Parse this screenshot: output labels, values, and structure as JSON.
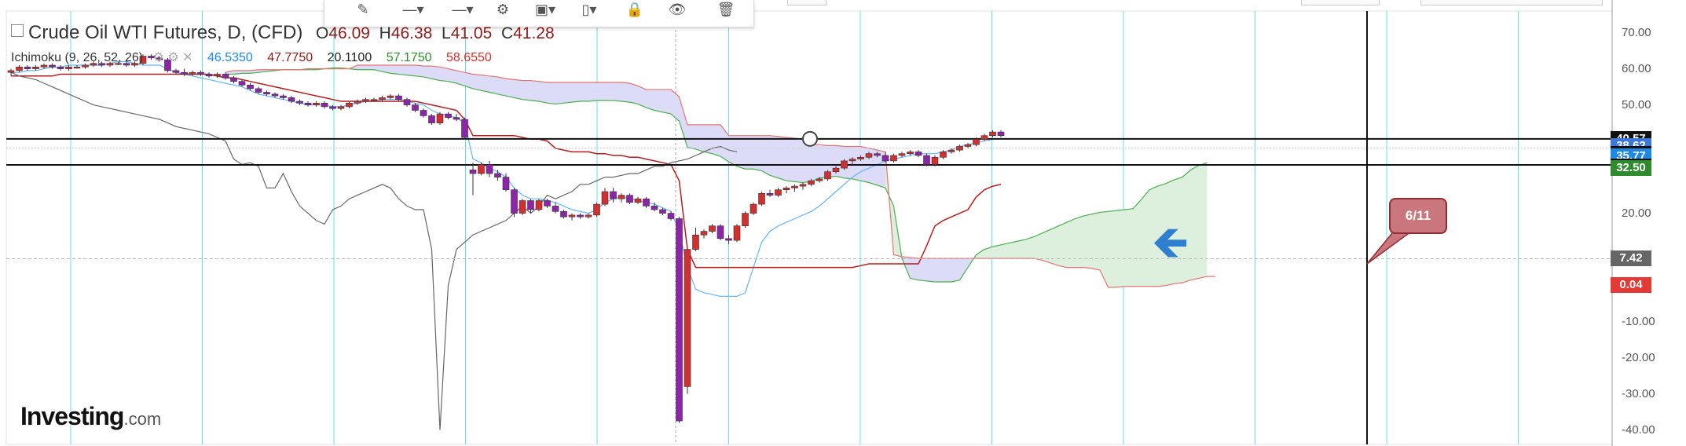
{
  "header": {
    "title": "Crude Oil WTI Futures, D, (CFD)",
    "open_label": "O",
    "open": "46.09",
    "high_label": "H",
    "high": "46.38",
    "low_label": "L",
    "low": "41.05",
    "close_label": "C",
    "close": "41.28"
  },
  "indicator": {
    "name": "Ichimoku (9, 26, 52, 26)",
    "values": [
      {
        "text": "46.5350",
        "color": "#1e88e5"
      },
      {
        "text": "47.7750",
        "color": "#8b1a1a"
      },
      {
        "text": "20.1100",
        "color": "#222222"
      },
      {
        "text": "57.1750",
        "color": "#2e8b2e"
      },
      {
        "text": "58.6550",
        "color": "#d32f2f"
      }
    ]
  },
  "toolbar": {
    "items": [
      "pencil-icon",
      "line-style-icon",
      "line-width-icon",
      "gear-icon",
      "copy-icon",
      "template-icon",
      "lock-icon",
      "eye-icon",
      "trash-icon"
    ]
  },
  "annotation": {
    "callout": "6/11"
  },
  "logo": {
    "main": "Investing",
    "suffix": ".com"
  },
  "price_tags": [
    {
      "text": "40.57",
      "bg": "#111111",
      "fg": "#ffffff",
      "value": 40.57
    },
    {
      "text": "38.62",
      "bg": "#3b78d8",
      "fg": "#ffffff",
      "value": 38.62
    },
    {
      "text": "38.62",
      "bg": "#111111",
      "fg": "#ffffff",
      "value": 36.4
    },
    {
      "text": "35.77",
      "bg": "#1e88e5",
      "fg": "#ffffff",
      "value": 35.77
    },
    {
      "text": "32.86",
      "bg": "#111111",
      "fg": "#ffffff",
      "value": 32.86
    },
    {
      "text": "32.50",
      "bg": "#2e8b2e",
      "fg": "#ffffff",
      "value": 32.5
    },
    {
      "text": "7.42",
      "bg": "#666666",
      "fg": "#ffffff",
      "value": 7.42
    },
    {
      "text": "0.04",
      "bg": "#e53935",
      "fg": "#ffffff",
      "value": 0.04
    }
  ],
  "chart_data": {
    "type": "candlestick",
    "ylim": [
      -44,
      76
    ],
    "y_ticks": [
      "70.00",
      "60.00",
      "50.00",
      "40.00",
      "30.00",
      "20.00",
      "10.00",
      "0.00",
      "-10.00",
      "-20.00",
      "-30.00",
      "-40.00"
    ],
    "horizontal_lines": [
      40.6,
      33.4
    ],
    "colors": {
      "up": "#d32f2f",
      "down": "#8e24aa",
      "tenkan": "#64b5f6",
      "kijun": "#b71c1c",
      "chikou": "#666666",
      "span_a": "#4caf50",
      "span_b": "#e57373",
      "cloud_bear": "#dcdcf8",
      "cloud_bull": "#ddf0dd",
      "vgrid": "#66e0e8"
    },
    "candles": [
      [
        59,
        60,
        58,
        59.5
      ],
      [
        59.5,
        61,
        59,
        60.5
      ],
      [
        60.5,
        61,
        59.5,
        60
      ],
      [
        60,
        61,
        59.5,
        60.5
      ],
      [
        60.5,
        61.5,
        60,
        61
      ],
      [
        61,
        61.5,
        60,
        60.5
      ],
      [
        60.5,
        61,
        59.5,
        60
      ],
      [
        60,
        61,
        59.5,
        60.5
      ],
      [
        60.5,
        61,
        60,
        60.5
      ],
      [
        60.5,
        61.5,
        60,
        61
      ],
      [
        61,
        62,
        60.5,
        61.5
      ],
      [
        61.5,
        62,
        60.5,
        61
      ],
      [
        61,
        62,
        60.5,
        61.5
      ],
      [
        61.5,
        62,
        61,
        61.5
      ],
      [
        61.5,
        62,
        60.5,
        61
      ],
      [
        61,
        62,
        60.5,
        61.5
      ],
      [
        61.5,
        64,
        61,
        63.5
      ],
      [
        63.5,
        64,
        62.5,
        63
      ],
      [
        63,
        63.5,
        62,
        62.5
      ],
      [
        62.5,
        63,
        59,
        59.5
      ],
      [
        59.5,
        60,
        58.5,
        59
      ],
      [
        59,
        60,
        58,
        58.5
      ],
      [
        58.5,
        59.5,
        58,
        59
      ],
      [
        59,
        59.5,
        58,
        58.5
      ],
      [
        58.5,
        59,
        57.5,
        58
      ],
      [
        58,
        59,
        57.5,
        58.5
      ],
      [
        58.5,
        59,
        57,
        57.5
      ],
      [
        57.5,
        58,
        56,
        56.5
      ],
      [
        56.5,
        57,
        55,
        55.5
      ],
      [
        55.5,
        56,
        54,
        54.5
      ],
      [
        54.5,
        55,
        53,
        53.5
      ],
      [
        53.5,
        54,
        52.5,
        53
      ],
      [
        53,
        53.5,
        52,
        52.5
      ],
      [
        52.5,
        53,
        51.5,
        52
      ],
      [
        52,
        52.5,
        50.5,
        51
      ],
      [
        51,
        51.5,
        50,
        50.5
      ],
      [
        50.5,
        51,
        49.5,
        50
      ],
      [
        50,
        51,
        49.5,
        50.5
      ],
      [
        50.5,
        51,
        49,
        49.5
      ],
      [
        49.5,
        50,
        48.5,
        49
      ],
      [
        49,
        50,
        48.5,
        49.5
      ],
      [
        49.5,
        51,
        49,
        50.5
      ],
      [
        50.5,
        51.5,
        50,
        51
      ],
      [
        51,
        52,
        50.5,
        51.5
      ],
      [
        51.5,
        52,
        51,
        51.5
      ],
      [
        51.5,
        52.5,
        51,
        52
      ],
      [
        52,
        53,
        51.5,
        52.5
      ],
      [
        52.5,
        53,
        51,
        51.5
      ],
      [
        51.5,
        52,
        49.5,
        50
      ],
      [
        50,
        50.5,
        48,
        48.5
      ],
      [
        48.5,
        49,
        46.5,
        47
      ],
      [
        47,
        47.5,
        44.5,
        45
      ],
      [
        45,
        48,
        44.5,
        47.5
      ],
      [
        47.5,
        48,
        46,
        46.5
      ],
      [
        46.5,
        47.5,
        45.5,
        46
      ],
      [
        46,
        46.5,
        40.5,
        41
      ],
      [
        32,
        34,
        25,
        31
      ],
      [
        31,
        34,
        30.5,
        33.5
      ],
      [
        33.5,
        34.5,
        30,
        31
      ],
      [
        31,
        32,
        29,
        30
      ],
      [
        30,
        31,
        26,
        26.5
      ],
      [
        26.5,
        27,
        19,
        20
      ],
      [
        20,
        24,
        19.5,
        23.5
      ],
      [
        23.5,
        24,
        20,
        21
      ],
      [
        21,
        24,
        20.5,
        23.5
      ],
      [
        23.5,
        24,
        21.5,
        22
      ],
      [
        22,
        23,
        20,
        20.5
      ],
      [
        20.5,
        21,
        18.5,
        19
      ],
      [
        19,
        20,
        18,
        19.5
      ],
      [
        19.5,
        20,
        18.5,
        19
      ],
      [
        19,
        20,
        18.5,
        19.5
      ],
      [
        19.5,
        23,
        19,
        22.5
      ],
      [
        22.5,
        27,
        22,
        26
      ],
      [
        26,
        27,
        23,
        24
      ],
      [
        24,
        25.5,
        23,
        25
      ],
      [
        25,
        25.5,
        22.5,
        23
      ],
      [
        23,
        24.5,
        22.5,
        24
      ],
      [
        24,
        24.5,
        21.5,
        22
      ],
      [
        22,
        23,
        20.5,
        21
      ],
      [
        21,
        21.5,
        19.5,
        20
      ],
      [
        20,
        20.5,
        18,
        18.5
      ],
      [
        18.5,
        19,
        -38,
        -37.5
      ],
      [
        -28,
        -12,
        -30,
        10
      ],
      [
        10,
        16,
        9.5,
        14
      ],
      [
        14,
        15.5,
        13,
        15
      ],
      [
        15,
        17,
        14.5,
        16.5
      ],
      [
        16.5,
        17,
        12.5,
        13
      ],
      [
        13,
        14,
        11.5,
        12.5
      ],
      [
        12.5,
        17,
        12,
        16.5
      ],
      [
        16.5,
        20.5,
        16,
        20
      ],
      [
        20,
        23,
        19.5,
        22.5
      ],
      [
        22.5,
        26,
        22,
        25.5
      ],
      [
        25.5,
        26.5,
        24.5,
        25
      ],
      [
        25,
        27,
        24.5,
        26.5
      ],
      [
        26.5,
        27.5,
        25.5,
        27
      ],
      [
        27,
        28,
        26,
        27.5
      ],
      [
        27.5,
        28.5,
        26.5,
        28
      ],
      [
        28,
        29.5,
        27.5,
        29
      ],
      [
        29,
        30,
        28.5,
        29.5
      ],
      [
        29.5,
        32,
        29,
        31.5
      ],
      [
        31.5,
        33,
        31,
        32.5
      ],
      [
        32.5,
        35,
        32,
        34.5
      ],
      [
        34.5,
        35.5,
        33.5,
        35
      ],
      [
        35,
        36,
        34.5,
        35.5
      ],
      [
        35.5,
        37,
        35,
        36.5
      ],
      [
        36.5,
        37,
        35.5,
        36
      ],
      [
        36,
        37,
        34,
        34.5
      ],
      [
        34.5,
        36.5,
        34,
        36
      ],
      [
        36,
        37,
        35.5,
        36.5
      ],
      [
        36.5,
        37.5,
        36,
        37
      ],
      [
        37,
        37.5,
        35.5,
        36
      ],
      [
        36,
        36.5,
        33,
        33.5
      ],
      [
        33.5,
        36,
        33,
        35.5
      ],
      [
        35.5,
        37.5,
        35,
        37
      ],
      [
        37,
        38,
        36.5,
        37.5
      ],
      [
        37.5,
        39,
        37,
        38.5
      ],
      [
        38.5,
        39.5,
        38,
        39
      ],
      [
        39,
        41,
        38.5,
        40.5
      ],
      [
        40.5,
        42,
        40,
        41.5
      ],
      [
        41.5,
        43,
        41,
        42.5
      ],
      [
        42.5,
        43,
        41,
        41.5
      ]
    ],
    "tenkan": [
      59,
      59,
      59.5,
      59.5,
      60,
      60.5,
      60.5,
      61,
      61,
      61,
      61,
      61,
      61.5,
      62,
      62,
      61.5,
      61,
      61,
      61,
      60,
      59,
      58.5,
      58,
      57.5,
      57,
      56.5,
      56,
      55.5,
      55,
      54,
      53,
      52.5,
      52,
      51.5,
      51,
      50.5,
      50,
      50,
      50,
      49.5,
      49.5,
      50,
      50.5,
      51,
      51,
      51.5,
      51.5,
      51.5,
      51,
      50.5,
      50,
      48.5,
      47.5,
      47,
      46.5,
      45,
      35,
      34,
      32.5,
      31.5,
      30,
      27,
      25,
      24,
      24,
      23.5,
      23,
      22,
      21,
      20.5,
      20,
      21,
      23,
      24,
      24.5,
      24,
      23.5,
      23,
      22.5,
      21.5,
      20.5,
      15,
      5,
      -1,
      -2,
      -2.5,
      -3,
      -3,
      -3,
      -2,
      5,
      12,
      15,
      16.5,
      17.5,
      18.5,
      19.5,
      20.5,
      22,
      24,
      26,
      28,
      30,
      31.5,
      32.5,
      33.5,
      34.5,
      35,
      35.5,
      36,
      36.5,
      36.5,
      36.5,
      37,
      37.5,
      38.5,
      39,
      39.5,
      40,
      40.5
    ],
    "kijun": [
      58,
      58,
      58,
      58,
      58,
      58,
      58.5,
      58.5,
      58.5,
      58.5,
      58.5,
      58.5,
      58.5,
      58.5,
      58.5,
      58.5,
      58.5,
      58.5,
      58.5,
      58.5,
      58.5,
      58.5,
      58.5,
      58.5,
      58.5,
      58,
      57.5,
      57.5,
      57,
      56.5,
      56,
      55.5,
      55,
      54.5,
      54,
      53.5,
      53,
      52.5,
      52,
      51.5,
      51,
      51,
      51,
      51,
      51,
      51,
      51,
      51,
      51,
      51,
      50.5,
      50,
      49.5,
      49,
      48.5,
      46,
      41.5,
      41.5,
      41.5,
      41.5,
      41.5,
      41.5,
      41,
      40.5,
      40.5,
      40,
      38,
      37.5,
      37,
      37,
      37,
      36.5,
      36.5,
      36,
      36,
      35.5,
      35.5,
      35,
      34.5,
      34,
      33.5,
      29,
      10,
      5,
      5,
      5,
      5,
      5,
      5,
      5,
      5,
      5,
      5,
      5,
      5,
      5,
      5,
      5,
      5,
      5,
      5,
      5,
      5,
      5.5,
      6,
      6,
      6,
      6,
      6,
      6,
      6,
      11,
      16.5,
      18,
      19,
      20,
      21,
      24.5,
      26.5,
      27.5,
      28
    ],
    "chikou": [
      59,
      58,
      57.5,
      57,
      56,
      55,
      54,
      53,
      52,
      51,
      50,
      49.5,
      49,
      48.5,
      48,
      47.5,
      47,
      46.5,
      46,
      45,
      44,
      43.5,
      43,
      42.5,
      42,
      41,
      40,
      35,
      33.5,
      34,
      33,
      27,
      27,
      31,
      26,
      22,
      20,
      18,
      17,
      21,
      22,
      24,
      25,
      26,
      27,
      28,
      27,
      24,
      22,
      21,
      21,
      10,
      -40,
      0,
      10,
      12,
      14,
      15,
      16,
      17,
      18,
      20,
      22,
      20,
      22,
      25,
      24,
      25,
      26,
      28,
      28,
      29,
      30,
      30,
      30.5,
      31,
      31,
      32,
      33,
      33,
      34,
      34.5,
      35,
      36,
      37,
      38,
      38.5,
      37.5,
      37
    ]
  }
}
